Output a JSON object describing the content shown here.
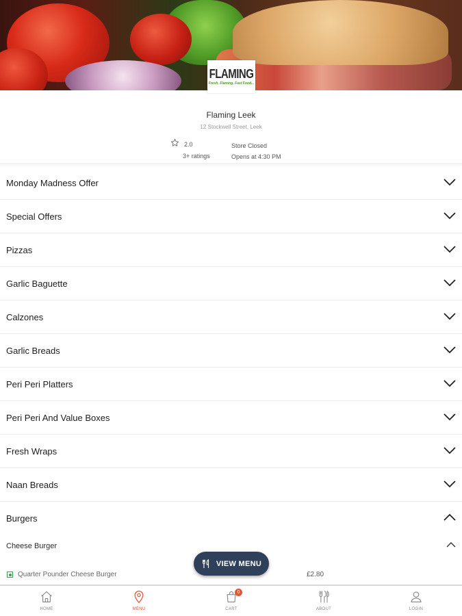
{
  "store": {
    "logo_text": "FLAMING",
    "logo_tagline": "Fresh, Flaming, Fast Food...",
    "name": "Flaming Leek",
    "address": "12 Stockwell Street, Leek",
    "rating": "2.0",
    "rating_count": "3+ ratings",
    "status": "Store Closed",
    "opens": "Opens at 4:30 PM"
  },
  "categories": [
    {
      "label": "Monday Madness Offer",
      "expanded": false
    },
    {
      "label": "Special Offers",
      "expanded": false
    },
    {
      "label": "Pizzas",
      "expanded": false
    },
    {
      "label": "Garlic Baguette",
      "expanded": false
    },
    {
      "label": "Calzones",
      "expanded": false
    },
    {
      "label": "Garlic Breads",
      "expanded": false
    },
    {
      "label": "Peri Peri Platters",
      "expanded": false
    },
    {
      "label": "Peri Peri And Value Boxes",
      "expanded": false
    },
    {
      "label": "Fresh Wraps",
      "expanded": false
    },
    {
      "label": "Naan Breads",
      "expanded": false
    },
    {
      "label": "Burgers",
      "expanded": true
    }
  ],
  "subcategory": {
    "label": "Cheese Burger",
    "expanded": true
  },
  "item": {
    "name": "Quarter Pounder Cheese Burger",
    "price": "£2.80"
  },
  "view_menu": {
    "label": "VIEW MENU"
  },
  "nav": {
    "home": "HOME",
    "menu": "MENU",
    "cart": "CART",
    "cart_count": "0",
    "about": "ABOUT",
    "login": "LOGIN",
    "active": "menu"
  },
  "colors": {
    "accent": "#e0563a",
    "button_bg": "#2f405a",
    "veg_green": "#33a04a"
  }
}
